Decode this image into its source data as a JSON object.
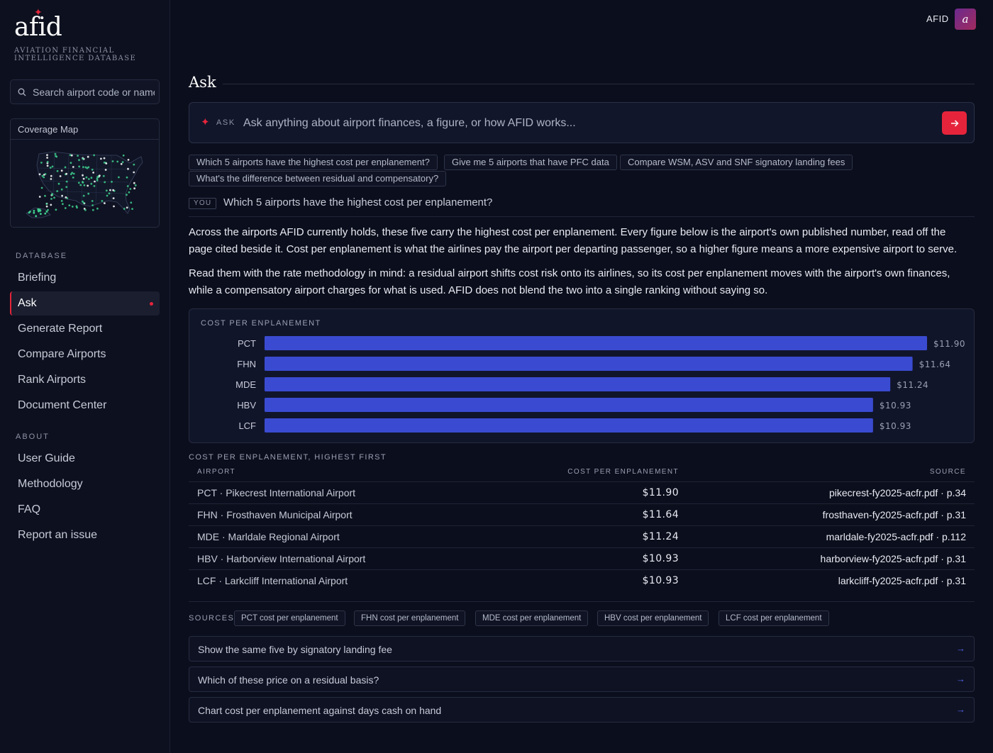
{
  "brand": {
    "logo": "afid",
    "subtitle": "AVIATION FINANCIAL INTELLIGENCE DATABASE"
  },
  "search": {
    "placeholder": "Search airport code or name"
  },
  "coverage": {
    "title": "Coverage Map"
  },
  "nav": {
    "database_label": "DATABASE",
    "database_items": [
      "Briefing",
      "Ask",
      "Generate Report",
      "Compare Airports",
      "Rank Airports",
      "Document Center"
    ],
    "about_label": "ABOUT",
    "about_items": [
      "User Guide",
      "Methodology",
      "FAQ",
      "Report an issue"
    ],
    "active": "Ask"
  },
  "header": {
    "user": "AFID",
    "avatar_letter": "a"
  },
  "page": {
    "title": "Ask"
  },
  "ask": {
    "label": "ASK",
    "placeholder": "Ask anything about airport finances, a figure, or how AFID works..."
  },
  "suggestions": [
    "Which 5 airports have the highest cost per enplanement?",
    "Give me 5 airports that have PFC data",
    "Compare WSM, ASV and SNF signatory landing fees",
    "What's the difference between residual and compensatory?"
  ],
  "conversation": {
    "you_tag": "YOU",
    "question": "Which 5 airports have the highest cost per enplanement?",
    "paragraph1": "Across the airports AFID currently holds, these five carry the highest cost per enplanement. Every figure below is the airport's own published number, read off the page cited beside it. Cost per enplanement is what the airlines pay the airport per departing passenger, so a higher figure means a more expensive airport to serve.",
    "paragraph2": "Read them with the rate methodology in mind: a residual airport shifts cost risk onto its airlines, so its cost per enplanement moves with the airport's own finances, while a compensatory airport charges for what is used. AFID does not blend the two into a single ranking without saying so."
  },
  "chart_data": {
    "type": "bar",
    "orientation": "horizontal",
    "title": "COST PER ENPLANEMENT",
    "categories": [
      "PCT",
      "FHN",
      "MDE",
      "HBV",
      "LCF"
    ],
    "values": [
      11.9,
      11.64,
      11.24,
      10.93,
      10.93
    ],
    "value_labels": [
      "$11.90",
      "$11.64",
      "$11.24",
      "$10.93",
      "$10.93"
    ],
    "bar_color": "#3a4bd1",
    "grid": false
  },
  "table": {
    "title": "COST PER ENPLANEMENT, HIGHEST FIRST",
    "headers": [
      "AIRPORT",
      "COST PER ENPLANEMENT",
      "SOURCE"
    ],
    "rows": [
      {
        "airport": "PCT · Pikecrest International Airport",
        "value": "$11.90",
        "source": "pikecrest-fy2025-acfr.pdf · p.34"
      },
      {
        "airport": "FHN · Frosthaven Municipal Airport",
        "value": "$11.64",
        "source": "frosthaven-fy2025-acfr.pdf · p.31"
      },
      {
        "airport": "MDE · Marldale Regional Airport",
        "value": "$11.24",
        "source": "marldale-fy2025-acfr.pdf · p.112"
      },
      {
        "airport": "HBV · Harborview International Airport",
        "value": "$10.93",
        "source": "harborview-fy2025-acfr.pdf · p.31"
      },
      {
        "airport": "LCF · Larkcliff International Airport",
        "value": "$10.93",
        "source": "larkcliff-fy2025-acfr.pdf · p.31"
      }
    ]
  },
  "sources": {
    "label": "SOURCES",
    "items": [
      "PCT cost per enplanement",
      "FHN cost per enplanement",
      "MDE cost per enplanement",
      "HBV cost per enplanement",
      "LCF cost per enplanement"
    ]
  },
  "followups": [
    "Show the same five by signatory landing fee",
    "Which of these price on a residual basis?",
    "Chart cost per enplanement against days cash on hand"
  ],
  "colors": {
    "accent": "#e5243b",
    "bar": "#3a4bd1",
    "link_arrow": "#5564e8",
    "map_dot": "#3ecf8e"
  }
}
